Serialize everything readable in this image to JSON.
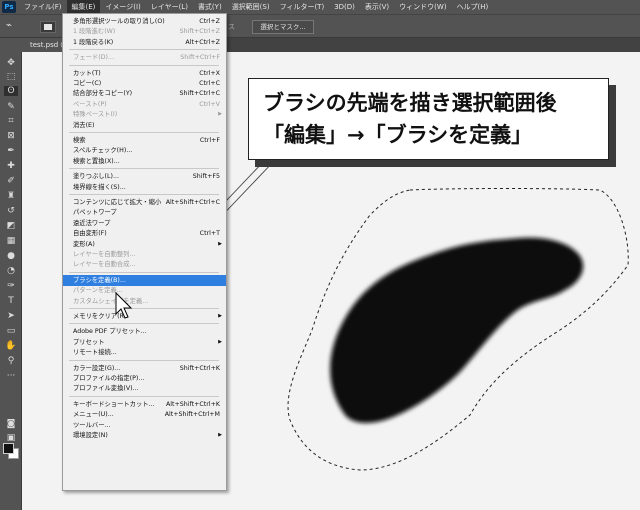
{
  "app": {
    "logo": "Ps"
  },
  "menubar": [
    "ファイル(F)",
    "編集(E)",
    "イメージ(I)",
    "レイヤー(L)",
    "書式(Y)",
    "選択範囲(S)",
    "フィルター(T)",
    "3D(D)",
    "表示(V)",
    "ウィンドウ(W)",
    "ヘルプ(H)"
  ],
  "options_bar": {
    "mask_button": "選択とマスク...",
    "partial_label": "ス"
  },
  "document": {
    "tab": "test.psd @"
  },
  "colors": {
    "highlight": "#2f7fe0",
    "menu_bg": "#f0f0f0",
    "ui_bg": "#535353",
    "canvas": "#f3f3f3"
  },
  "edit_menu": {
    "items": [
      {
        "label": "多角形選択ツールの取り消し(O)",
        "shortcut": "Ctrl+Z"
      },
      {
        "label": "1 段階進む(W)",
        "shortcut": "Shift+Ctrl+Z",
        "disabled": true
      },
      {
        "label": "1 段階戻る(K)",
        "shortcut": "Alt+Ctrl+Z"
      },
      {
        "sep": true
      },
      {
        "label": "フェード(D)...",
        "shortcut": "Shift+Ctrl+F",
        "disabled": true
      },
      {
        "sep": true
      },
      {
        "label": "カット(T)",
        "shortcut": "Ctrl+X"
      },
      {
        "label": "コピー(C)",
        "shortcut": "Ctrl+C"
      },
      {
        "label": "結合部分をコピー(Y)",
        "shortcut": "Shift+Ctrl+C"
      },
      {
        "label": "ペースト(P)",
        "shortcut": "Ctrl+V",
        "disabled": true
      },
      {
        "label": "特殊ペースト(I)",
        "submenu": true,
        "disabled": true
      },
      {
        "label": "消去(E)"
      },
      {
        "sep": true
      },
      {
        "label": "検索",
        "shortcut": "Ctrl+F"
      },
      {
        "label": "スペルチェック(H)..."
      },
      {
        "label": "検索と置換(X)..."
      },
      {
        "sep": true
      },
      {
        "label": "塗りつぶし(L)...",
        "shortcut": "Shift+F5"
      },
      {
        "label": "境界線を描く(S)..."
      },
      {
        "sep": true
      },
      {
        "label": "コンテンツに応じて拡大・縮小",
        "shortcut": "Alt+Shift+Ctrl+C"
      },
      {
        "label": "パペットワープ"
      },
      {
        "label": "遠近法ワープ"
      },
      {
        "label": "自由変形(F)",
        "shortcut": "Ctrl+T"
      },
      {
        "label": "変形(A)",
        "submenu": true
      },
      {
        "label": "レイヤーを自動整列...",
        "disabled": true
      },
      {
        "label": "レイヤーを自動合成...",
        "disabled": true
      },
      {
        "sep": true
      },
      {
        "label": "ブラシを定義(B)...",
        "highlight": true
      },
      {
        "label": "パターンを定義...",
        "disabled": true
      },
      {
        "label": "カスタムシェイプを定義...",
        "disabled": true
      },
      {
        "sep": true
      },
      {
        "label": "メモリをクリア(R)",
        "submenu": true
      },
      {
        "sep": true
      },
      {
        "label": "Adobe PDF プリセット..."
      },
      {
        "label": "プリセット",
        "submenu": true
      },
      {
        "label": "リモート接続..."
      },
      {
        "sep": true
      },
      {
        "label": "カラー設定(G)...",
        "shortcut": "Shift+Ctrl+K"
      },
      {
        "label": "プロファイルの指定(P)..."
      },
      {
        "label": "プロファイル変換(V)..."
      },
      {
        "sep": true
      },
      {
        "label": "キーボードショートカット...",
        "shortcut": "Alt+Shift+Ctrl+K"
      },
      {
        "label": "メニュー(U)...",
        "shortcut": "Alt+Shift+Ctrl+M"
      },
      {
        "label": "ツールバー..."
      },
      {
        "label": "環境設定(N)",
        "submenu": true
      }
    ]
  },
  "callout": {
    "line1": "ブラシの先端を描き選択範囲後",
    "line2": "「編集」→「ブラシを定義」"
  }
}
